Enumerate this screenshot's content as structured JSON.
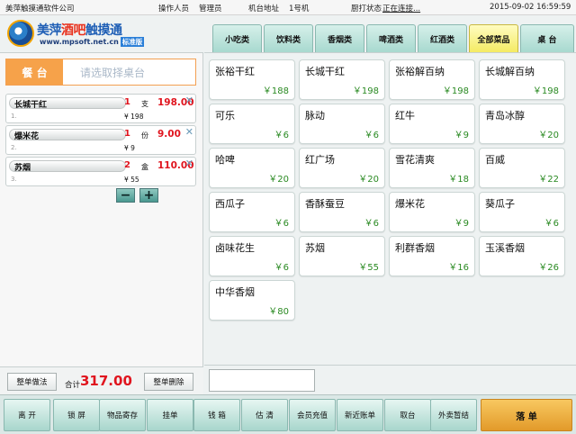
{
  "topbar": {
    "company": "美萍触摸通软件公司",
    "operator_label": "操作人员",
    "operator_name": "管理员",
    "terminal_label": "机台地址",
    "terminal_value": "1号机",
    "kitchen_label": "厨打状态",
    "kitchen_status": "正在连接...",
    "datetime": "2015-09-02 16:59:59"
  },
  "logo": {
    "title_part1": "美萍",
    "title_part2": "酒吧",
    "title_part3": "触摸通",
    "url": "www.mpsoft.net.cn",
    "edition": "标准版"
  },
  "tabs": [
    {
      "label": "小吃类",
      "active": false
    },
    {
      "label": "饮料类",
      "active": false
    },
    {
      "label": "香烟类",
      "active": false
    },
    {
      "label": "啤酒类",
      "active": false
    },
    {
      "label": "红酒类",
      "active": false
    },
    {
      "label": "全部菜品",
      "active": true
    },
    {
      "label": "桌 台",
      "active": false
    }
  ],
  "table_selector": {
    "label": "餐 台",
    "placeholder": "请选取择桌台"
  },
  "order_items": [
    {
      "name": "长城干红",
      "index": "1.",
      "qty": "1",
      "unit": "支",
      "price": "¥ 198",
      "total": "198.00"
    },
    {
      "name": "爆米花",
      "index": "2.",
      "qty": "1",
      "unit": "份",
      "price": "¥ 9",
      "total": "9.00"
    },
    {
      "name": "苏烟",
      "index": "3.",
      "qty": "2",
      "unit": "盒",
      "price": "¥ 55",
      "total": "110.00"
    }
  ],
  "steppers": {
    "minus": "−",
    "plus": "+"
  },
  "summary": {
    "whole_method": "整单做法",
    "total_label": "合计",
    "total_value": "317.00",
    "whole_delete": "整单删除"
  },
  "dishes": [
    {
      "name": "张裕干红",
      "price": "￥188"
    },
    {
      "name": "长城干红",
      "price": "￥198"
    },
    {
      "name": "张裕解百纳",
      "price": "￥198"
    },
    {
      "name": "长城解百纳",
      "price": "￥198"
    },
    {
      "name": "可乐",
      "price": "￥6"
    },
    {
      "name": "脉动",
      "price": "￥6"
    },
    {
      "name": "红牛",
      "price": "￥9"
    },
    {
      "name": "青岛冰醇",
      "price": "￥20"
    },
    {
      "name": "哈啤",
      "price": "￥20"
    },
    {
      "name": "红广场",
      "price": "￥20"
    },
    {
      "name": "雪花清爽",
      "price": "￥18"
    },
    {
      "name": "百威",
      "price": "￥22"
    },
    {
      "name": "西瓜子",
      "price": "￥6"
    },
    {
      "name": "香酥蚕豆",
      "price": "￥6"
    },
    {
      "name": "爆米花",
      "price": "￥9"
    },
    {
      "name": "葵瓜子",
      "price": "￥6"
    },
    {
      "name": "卤味花生",
      "price": "￥6"
    },
    {
      "name": "苏烟",
      "price": "￥55"
    },
    {
      "name": "利群香烟",
      "price": "￥16"
    },
    {
      "name": "玉溪香烟",
      "price": "￥26"
    },
    {
      "name": "中华香烟",
      "price": "￥80"
    }
  ],
  "actions": [
    {
      "label": "离 开"
    },
    {
      "label": "锁 屏"
    },
    {
      "label": "物品寄存"
    },
    {
      "label": "挂单"
    },
    {
      "label": "钱 箱"
    },
    {
      "label": "估 清"
    },
    {
      "label": "会员充值"
    },
    {
      "label": "新近账单"
    },
    {
      "label": "取台"
    },
    {
      "label": "外卖暂结"
    },
    {
      "label": "落 单"
    }
  ],
  "colors": {
    "accent_orange": "#f6a24a",
    "price_green": "#2a8a22",
    "total_red": "#e0141e",
    "tab_active": "#f4ea60"
  }
}
